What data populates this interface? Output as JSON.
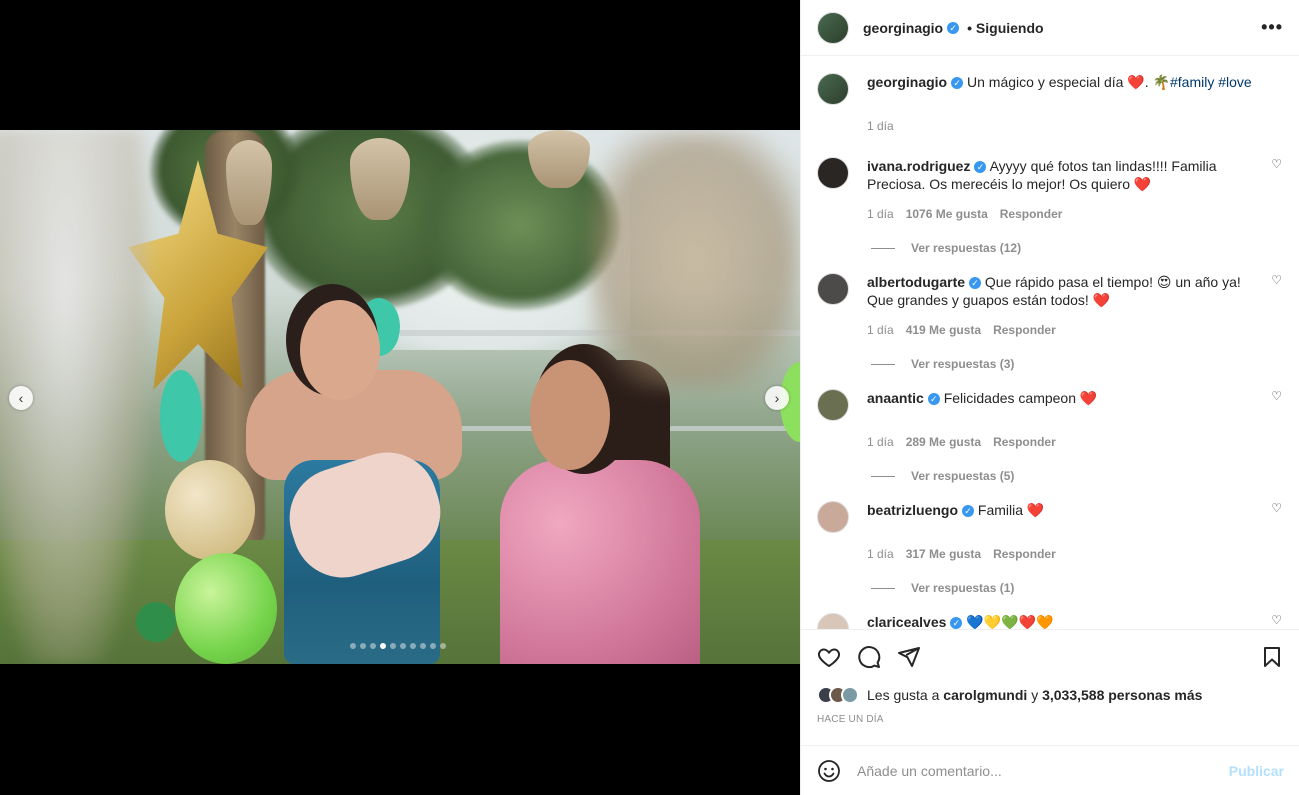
{
  "colors": {
    "accent": "#0095f6",
    "verified": "#3897f0",
    "heart": "#ed4956",
    "hashtag": "#00376b"
  },
  "header": {
    "username": "georginagio",
    "follow_label": "Siguiendo",
    "more": "•••"
  },
  "media": {
    "prev": "‹",
    "next": "›",
    "dot_count": 10,
    "active_dot_index": 3
  },
  "caption": {
    "username": "georginagio",
    "text_before": "Un mágico y especial día",
    "heart": "❤️",
    "text_mid": ". 🌴",
    "hashtag1": "#family",
    "hashtag2": "#love",
    "time": "1 día"
  },
  "comments": [
    {
      "username": "ivana.rodriguez",
      "text": "Ayyyy qué fotos tan lindas!!!! Familia Preciosa. Os merecéis lo mejor! Os quiero",
      "heart": "❤️",
      "time": "1 día",
      "likes": "1076 Me gusta",
      "reply": "Responder",
      "view_replies": "Ver respuestas (12)"
    },
    {
      "username": "albertodugarte",
      "text": "Que rápido pasa el tiempo! 😍 un año ya! Que grandes y guapos están todos!",
      "heart": "❤️",
      "time": "1 día",
      "likes": "419 Me gusta",
      "reply": "Responder",
      "view_replies": "Ver respuestas (3)"
    },
    {
      "username": "anaantic",
      "text": "Felicidades campeon",
      "heart": "❤️",
      "time": "1 día",
      "likes": "289 Me gusta",
      "reply": "Responder",
      "view_replies": "Ver respuestas (5)"
    },
    {
      "username": "beatrizluengo",
      "text": "Familia",
      "heart": "❤️",
      "time": "1 día",
      "likes": "317 Me gusta",
      "reply": "Responder",
      "view_replies": "Ver respuestas (1)"
    },
    {
      "username": "claricealves",
      "text": "💙💛💚❤️🧡"
    }
  ],
  "likes": {
    "prefix": "Les gusta a",
    "user": "carolgmundi",
    "middle": "y",
    "count": "3,033,588 personas más"
  },
  "timestamp": "HACE UN DÍA",
  "add_comment": {
    "placeholder": "Añade un comentario...",
    "publish": "Publicar"
  },
  "icons": {
    "like": "heart-outline-icon",
    "comment": "comment-bubble-icon",
    "share": "paper-plane-icon",
    "save": "bookmark-icon",
    "emoji": "smiley-icon",
    "verified": "verified-badge-icon"
  }
}
